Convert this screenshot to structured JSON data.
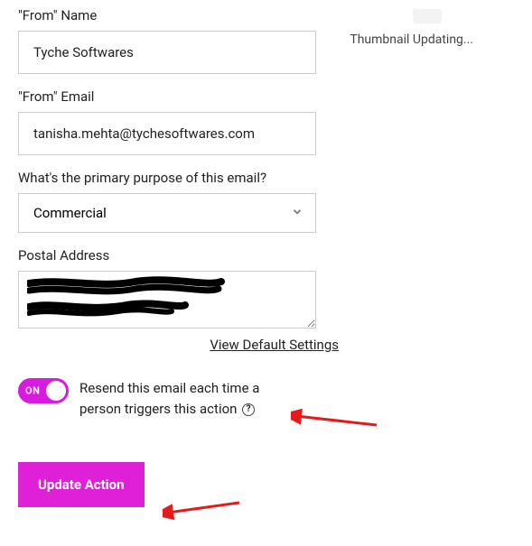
{
  "form": {
    "fromName": {
      "label": "\"From\" Name",
      "value": "Tyche Softwares"
    },
    "fromEmail": {
      "label": "\"From\" Email",
      "value": "tanisha.mehta@tychesoftwares.com"
    },
    "purpose": {
      "label": "What's the primary purpose of this email?",
      "value": "Commercial"
    },
    "postal": {
      "label": "Postal Address"
    },
    "defaultLink": "View Default Settings",
    "toggle": {
      "onText": "ON",
      "label": "Resend this email each time a person triggers this action "
    },
    "submit": "Update Action"
  },
  "thumbnail": {
    "text": "Thumbnail Updating..."
  }
}
